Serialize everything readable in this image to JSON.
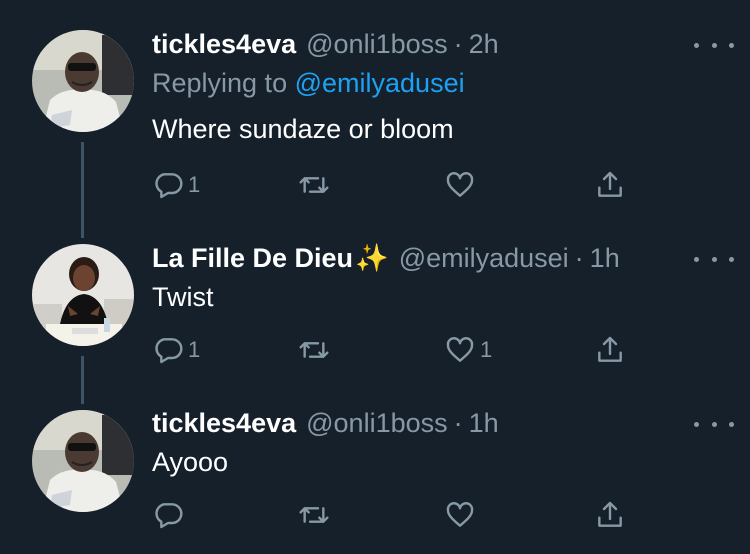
{
  "tweets": [
    {
      "display_name": "tickles4eva",
      "handle": "@onli1boss",
      "separator": "·",
      "time": "2h",
      "replying_prefix": "Replying to",
      "replying_to": "@emilyadusei",
      "text": "Where sundaze or bloom",
      "reply_count": "1",
      "retweet_count": "",
      "like_count": ""
    },
    {
      "display_name": "La Fille De Dieu",
      "emoji": "✨",
      "handle": "@emilyadusei",
      "separator": "·",
      "time": "1h",
      "text": "Twist",
      "reply_count": "1",
      "retweet_count": "",
      "like_count": "1"
    },
    {
      "display_name": "tickles4eva",
      "handle": "@onli1boss",
      "separator": "·",
      "time": "1h",
      "text": "Ayooo",
      "reply_count": "",
      "retweet_count": "",
      "like_count": ""
    }
  ],
  "colors": {
    "background": "#15202b",
    "secondary_text": "#8899a6",
    "link": "#1da1f2",
    "thread_line": "#3d5466"
  },
  "icons": [
    "reply-icon",
    "retweet-icon",
    "like-icon",
    "share-icon",
    "more-options-icon"
  ]
}
